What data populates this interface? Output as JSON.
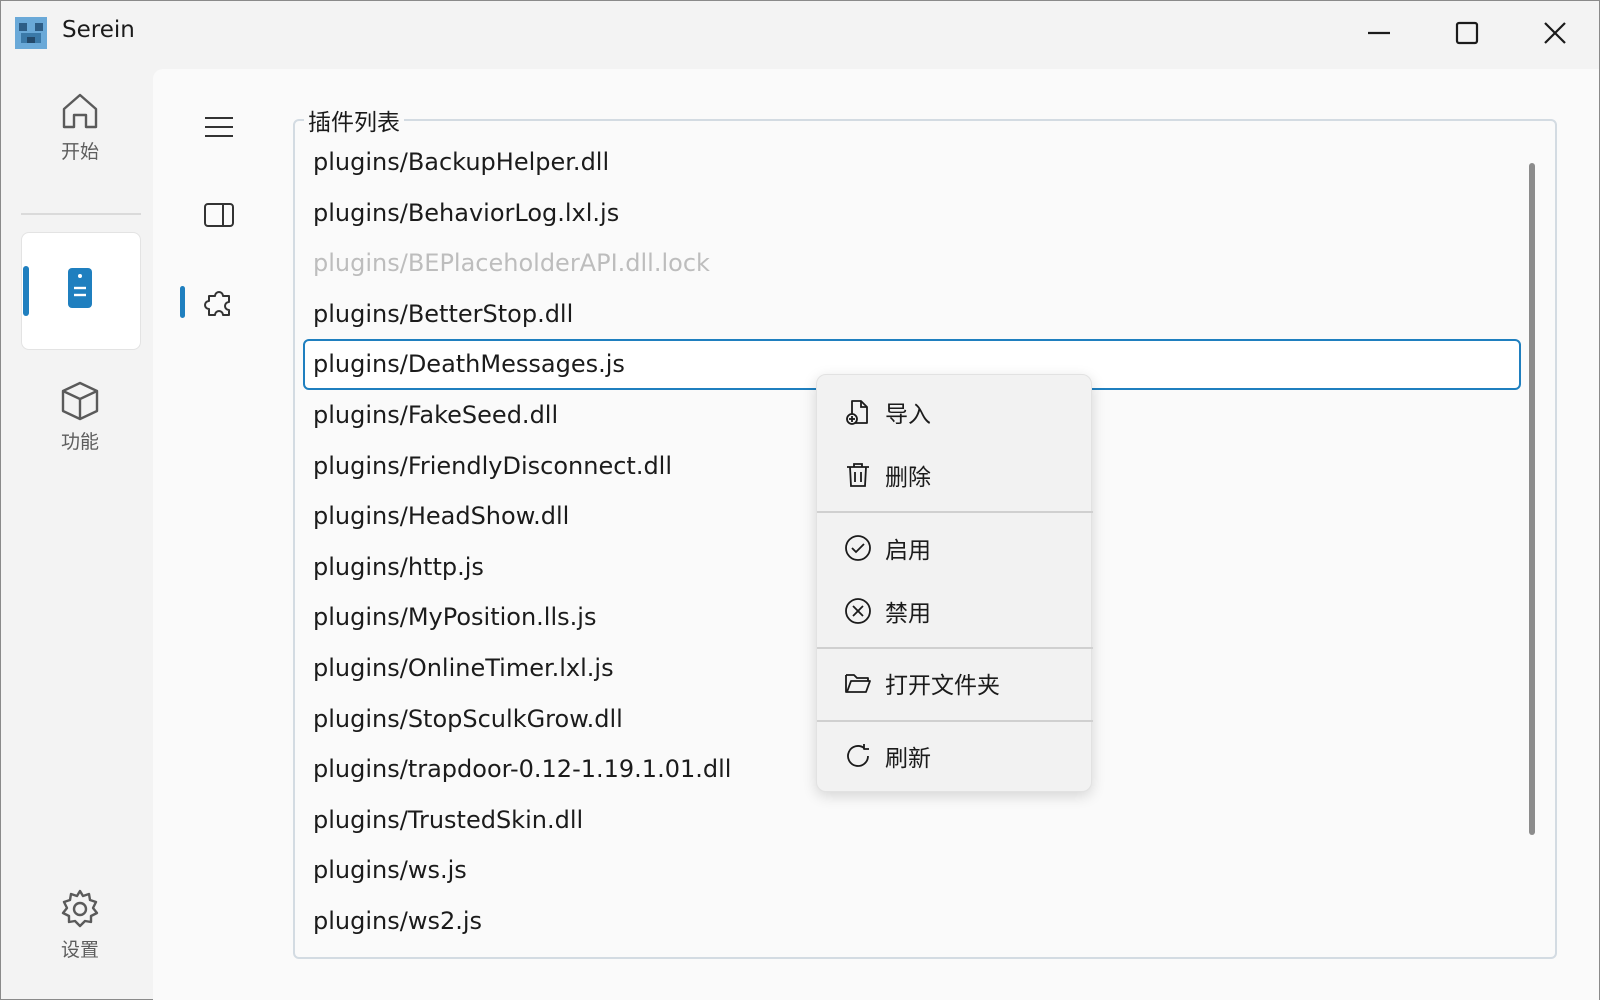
{
  "window": {
    "title": "Serein"
  },
  "nav": {
    "items": [
      {
        "label": "开始",
        "icon": "home-icon"
      },
      {
        "label": "",
        "icon": "server-icon",
        "selected": true
      },
      {
        "label": "功能",
        "icon": "cube-icon"
      },
      {
        "label": "设置",
        "icon": "gear-icon"
      }
    ]
  },
  "subnav": {
    "items": [
      {
        "icon": "menu-icon"
      },
      {
        "icon": "panel-icon"
      },
      {
        "icon": "puzzle-icon",
        "selected": true
      }
    ]
  },
  "plugins": {
    "title": "插件列表",
    "items": [
      {
        "name": "plugins/BackupHelper.dll",
        "state": "normal"
      },
      {
        "name": "plugins/BehaviorLog.lxl.js",
        "state": "normal"
      },
      {
        "name": "plugins/BEPlaceholderAPI.dll.lock",
        "state": "disabled"
      },
      {
        "name": "plugins/BetterStop.dll",
        "state": "normal"
      },
      {
        "name": "plugins/DeathMessages.js",
        "state": "selected"
      },
      {
        "name": "plugins/FakeSeed.dll",
        "state": "normal"
      },
      {
        "name": "plugins/FriendlyDisconnect.dll",
        "state": "normal"
      },
      {
        "name": "plugins/HeadShow.dll",
        "state": "normal"
      },
      {
        "name": "plugins/http.js",
        "state": "normal"
      },
      {
        "name": "plugins/MyPosition.lls.js",
        "state": "normal"
      },
      {
        "name": "plugins/OnlineTimer.lxl.js",
        "state": "normal"
      },
      {
        "name": "plugins/StopSculkGrow.dll",
        "state": "normal"
      },
      {
        "name": "plugins/trapdoor-0.12-1.19.1.01.dll",
        "state": "normal"
      },
      {
        "name": "plugins/TrustedSkin.dll",
        "state": "normal"
      },
      {
        "name": "plugins/ws.js",
        "state": "normal"
      },
      {
        "name": "plugins/ws2.js",
        "state": "normal"
      }
    ]
  },
  "context_menu": {
    "import": "导入",
    "delete": "删除",
    "enable": "启用",
    "disable": "禁用",
    "open_folder": "打开文件夹",
    "refresh": "刷新"
  },
  "colors": {
    "accent": "#1f7fbf",
    "disabled_text": "#bdbdbd"
  }
}
